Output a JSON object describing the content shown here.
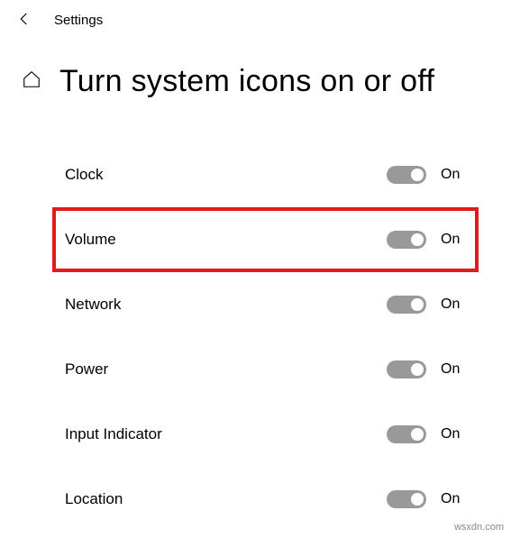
{
  "topbar": {
    "title": "Settings"
  },
  "header": {
    "title": "Turn system icons on or off"
  },
  "items": [
    {
      "label": "Clock",
      "state_label": "On",
      "highlight": false
    },
    {
      "label": "Volume",
      "state_label": "On",
      "highlight": true
    },
    {
      "label": "Network",
      "state_label": "On",
      "highlight": false
    },
    {
      "label": "Power",
      "state_label": "On",
      "highlight": false
    },
    {
      "label": "Input Indicator",
      "state_label": "On",
      "highlight": false
    },
    {
      "label": "Location",
      "state_label": "On",
      "highlight": false
    }
  ],
  "watermark": "wsxdn.com"
}
